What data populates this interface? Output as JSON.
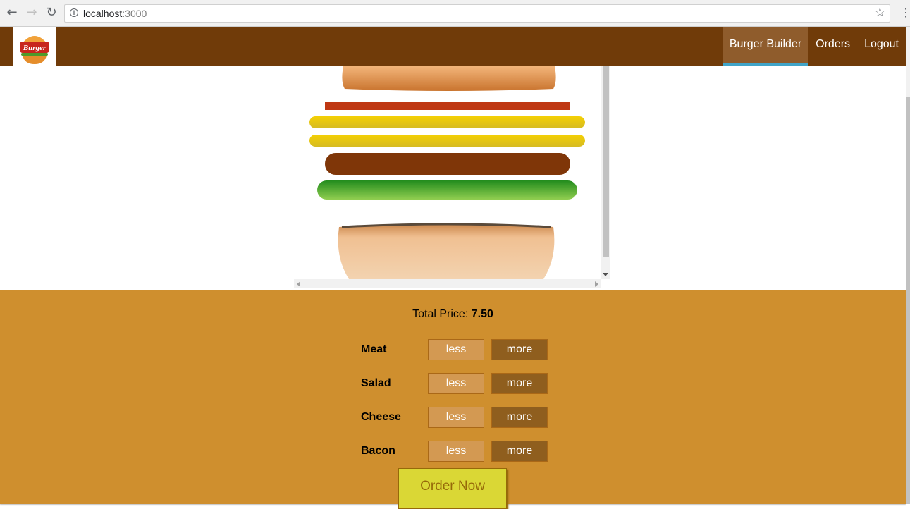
{
  "browser": {
    "url_host": "localhost",
    "url_port": ":3000"
  },
  "toolbar": {
    "logo_text": "Burger",
    "nav": [
      {
        "label": "Burger Builder",
        "active": true
      },
      {
        "label": "Orders",
        "active": false
      },
      {
        "label": "Logout",
        "active": false
      }
    ]
  },
  "build": {
    "price_label": "Total Price: ",
    "price_value": "7.50",
    "controls": [
      {
        "label": "Meat",
        "less": "less",
        "more": "more"
      },
      {
        "label": "Salad",
        "less": "less",
        "more": "more"
      },
      {
        "label": "Cheese",
        "less": "less",
        "more": "more"
      },
      {
        "label": "Bacon",
        "less": "less",
        "more": "more"
      }
    ],
    "order_button": "Order Now"
  },
  "colors": {
    "toolbar": "#703b09",
    "active_nav": "#8f5c2c",
    "active_indicator": "#40a4c8",
    "controls_bg": "#cf8f2e",
    "order_button": "#dad735"
  }
}
